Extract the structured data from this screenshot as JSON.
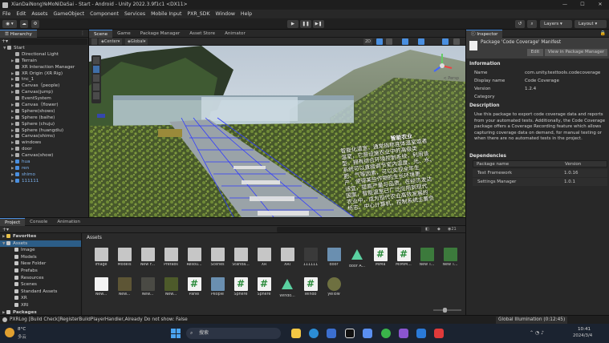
{
  "window": {
    "title": "XianDaiNongYeMoNiDaSai - Start - Android - Unity 2022.3.9f1c1 <DX11>",
    "minimize": "—",
    "maximize": "☐",
    "close": "✕"
  },
  "menu": [
    "File",
    "Edit",
    "Assets",
    "GameObject",
    "Component",
    "Services",
    "Mobile Input",
    "PXR_SDK",
    "Window",
    "Help"
  ],
  "toolbar": {
    "layers": "Layers",
    "layout": "Layout"
  },
  "hierarchy": {
    "tab": "Hierarchy",
    "items": [
      {
        "label": "Start",
        "depth": 0,
        "arrow": "▼"
      },
      {
        "label": "Directional Light",
        "depth": 1,
        "arrow": ""
      },
      {
        "label": "Terrain",
        "depth": 1,
        "arrow": "▶"
      },
      {
        "label": "XR Interaction Manager",
        "depth": 1,
        "arrow": ""
      },
      {
        "label": "XR Origin (XR Rig)",
        "depth": 1,
        "arrow": "▶"
      },
      {
        "label": "tnc_1",
        "depth": 1,
        "arrow": "▶"
      },
      {
        "label": "Canvas（people)",
        "depth": 1,
        "arrow": "▶"
      },
      {
        "label": "Canvas(jump)",
        "depth": 1,
        "arrow": "▶"
      },
      {
        "label": "EventSystem",
        "depth": 1,
        "arrow": ""
      },
      {
        "label": "Canvas（flower)",
        "depth": 1,
        "arrow": "▶"
      },
      {
        "label": "Sphere(shows)",
        "depth": 1,
        "arrow": "▶"
      },
      {
        "label": "Sphere (baihe)",
        "depth": 1,
        "arrow": "▶"
      },
      {
        "label": "Sphere (chuju)",
        "depth": 1,
        "arrow": "▶"
      },
      {
        "label": "Sphere (huangdiu)",
        "depth": 1,
        "arrow": "▶"
      },
      {
        "label": "Canvas(shims)",
        "depth": 1,
        "arrow": "▶"
      },
      {
        "label": "windows",
        "depth": 1,
        "arrow": "▶"
      },
      {
        "label": "door",
        "depth": 1,
        "arrow": "▶"
      },
      {
        "label": "Canvas(show)",
        "depth": 1,
        "arrow": "▶"
      },
      {
        "label": "hua",
        "depth": 1,
        "arrow": "▶",
        "blue": true
      },
      {
        "label": "ren",
        "depth": 1,
        "arrow": "▶",
        "blue": true
      },
      {
        "label": "shimo",
        "depth": 1,
        "arrow": "▶",
        "blue": true
      },
      {
        "label": "111111",
        "depth": 1,
        "arrow": "▶",
        "blue": true
      }
    ]
  },
  "scene": {
    "tabs": [
      "Scene",
      "Game",
      "Package Manager",
      "Asset Store",
      "Animator"
    ],
    "pivot": "Center",
    "space": "Global",
    "mode": "2D",
    "persp": "< Persp",
    "overlay_title": "智能农业",
    "overlay_lines": [
      "智能化温室，通常指称连体温室或者",
      "温室，它是设施农业中的高级类",
      "型，拥有综合环境控制系统，利用该",
      "系统可以直接调节室内温度、光、水、",
      "肥、气等因素，可以实现全年生",
      "产，使得某些作物的生长环境更",
      "适宜，提高产量与品质。在经济发达",
      "国家，智能温室已广泛应用到现代",
      "农业中，成为现代农业高效发展的",
      "标志。中心计算机，控制系统主要负"
    ]
  },
  "inspector": {
    "tab": "Inspector",
    "header": "Package 'Code Coverage' Manifest",
    "edit": "Edit",
    "view": "View in Package Manager",
    "info_title": "Information",
    "fields": [
      {
        "k": "Name",
        "v": "com.unity.testtools.codecoverage"
      },
      {
        "k": "Display name",
        "v": "Code Coverage"
      },
      {
        "k": "Version",
        "v": "1.2.4"
      },
      {
        "k": "Category",
        "v": ""
      }
    ],
    "desc_title": "Description",
    "desc": "Use this package to export code coverage data and reports from your automated tests. Additionally, the Code Coverage package offers a Coverage Recording feature which allows capturing coverage data on demand, for manual testing or when there are no automated tests in the project.",
    "deps_title": "Dependencies",
    "deps_header": {
      "k": "Package name",
      "v": "Version"
    },
    "deps": [
      {
        "k": "Test Framework",
        "v": "1.0.16"
      },
      {
        "k": "Settings Manager",
        "v": "1.0.1"
      }
    ]
  },
  "project": {
    "tabs": [
      "Project",
      "Console",
      "Animation"
    ],
    "count": "21",
    "tree": [
      {
        "label": "Favorites",
        "depth": 0,
        "arrow": "▶",
        "star": true
      },
      {
        "label": "Assets",
        "depth": 0,
        "arrow": "▼",
        "sel": true
      },
      {
        "label": "Image",
        "depth": 1
      },
      {
        "label": "Models",
        "depth": 1
      },
      {
        "label": "New Folder",
        "depth": 1
      },
      {
        "label": "Prefabs",
        "depth": 1
      },
      {
        "label": "Resources",
        "depth": 1
      },
      {
        "label": "Scenes",
        "depth": 1
      },
      {
        "label": "Standard Assets",
        "depth": 1
      },
      {
        "label": "XR",
        "depth": 1
      },
      {
        "label": "XRI",
        "depth": 1
      },
      {
        "label": "Packages",
        "depth": 0,
        "arrow": "▶"
      }
    ],
    "breadcrumb": "Assets",
    "assets_row1": [
      {
        "l": "Image",
        "t": "folder"
      },
      {
        "l": "Models",
        "t": "folder"
      },
      {
        "l": "New F...",
        "t": "folder"
      },
      {
        "l": "Prefabs",
        "t": "folder"
      },
      {
        "l": "Resou...",
        "t": "folder"
      },
      {
        "l": "Scenes",
        "t": "folder"
      },
      {
        "l": "Standa...",
        "t": "folder"
      },
      {
        "l": "XR",
        "t": "folder"
      },
      {
        "l": "XRI",
        "t": "folder"
      },
      {
        "l": "111111",
        "t": "model"
      },
      {
        "l": "door",
        "t": "prefab"
      },
      {
        "l": "door A...",
        "t": "anim"
      },
      {
        "l": "MiMa",
        "t": "script"
      },
      {
        "l": "MiMiM...",
        "t": "script"
      },
      {
        "l": "New T...",
        "t": "ctrl"
      },
      {
        "l": "New T...",
        "t": "ctrl"
      }
    ],
    "assets_row2": [
      {
        "l": "New...",
        "t": "doc"
      },
      {
        "l": "New...",
        "t": "mat1"
      },
      {
        "l": "New...",
        "t": "mat2"
      },
      {
        "l": "New...",
        "t": "mat3"
      },
      {
        "l": "Panel",
        "t": "script"
      },
      {
        "l": "People",
        "t": "prefab"
      },
      {
        "l": "Sphere",
        "t": "script"
      },
      {
        "l": "Sphere",
        "t": "script"
      },
      {
        "l": "Windo...",
        "t": "anim"
      },
      {
        "l": "Windo",
        "t": "script"
      },
      {
        "l": "yellow",
        "t": "sphere"
      }
    ]
  },
  "status": {
    "log": "PXRLog [Build Check]RegisterBuildPlayerHandler,Already Do not show: False",
    "gi": "Global Illumination (0:12:45)"
  },
  "taskbar": {
    "weather": "8°C",
    "weather_sub": "多云",
    "search": "搜索",
    "time": "10:41",
    "date": "2024/3/4"
  },
  "colors": {
    "accent": "#4a8fe0",
    "panel": "#282828"
  }
}
